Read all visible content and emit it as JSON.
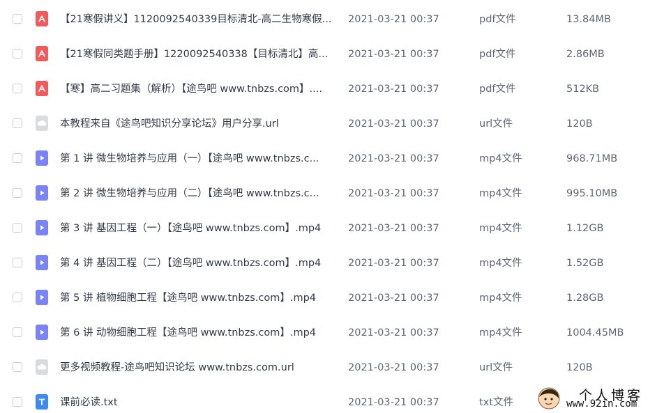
{
  "colors": {
    "pdf": "#f25b5b",
    "url": "#d9dbe0",
    "mp4": "#7b84f5",
    "txt": "#3c8bf0"
  },
  "files": [
    {
      "name": "【21寒假讲义】1120092540339目标清北-高二生物寒假...",
      "date": "2021-03-21 00:37",
      "type": "pdf文件",
      "size": "13.84MB",
      "icon": "pdf-icon"
    },
    {
      "name": "【21寒假同类题手册】1220092540338【目标清北】高...",
      "date": "2021-03-21 00:37",
      "type": "pdf文件",
      "size": "2.86MB",
      "icon": "pdf-icon"
    },
    {
      "name": "【寒】高二习题集（解析）【途鸟吧 www.tnbzs.com】....",
      "date": "2021-03-21 00:37",
      "type": "pdf文件",
      "size": "512KB",
      "icon": "pdf-icon"
    },
    {
      "name": "本教程来自《途鸟吧知识分享论坛》用户分享.url",
      "date": "2021-03-21 00:37",
      "type": "url文件",
      "size": "120B",
      "icon": "cloud-link-icon"
    },
    {
      "name": "第 1 讲 微生物培养与应用（一）【途鸟吧 www.tnbzs.c...",
      "date": "2021-03-21 00:37",
      "type": "mp4文件",
      "size": "968.71MB",
      "icon": "video-icon"
    },
    {
      "name": "第 2 讲 微生物培养与应用（二）【途鸟吧 www.tnbzs.c...",
      "date": "2021-03-21 00:37",
      "type": "mp4文件",
      "size": "995.10MB",
      "icon": "video-icon"
    },
    {
      "name": "第 3 讲 基因工程（一）【途鸟吧 www.tnbzs.com】.mp4",
      "date": "2021-03-21 00:37",
      "type": "mp4文件",
      "size": "1.12GB",
      "icon": "video-icon"
    },
    {
      "name": "第 4 讲 基因工程（二）【途鸟吧 www.tnbzs.com】.mp4",
      "date": "2021-03-21 00:37",
      "type": "mp4文件",
      "size": "1.52GB",
      "icon": "video-icon"
    },
    {
      "name": "第 5 讲 植物细胞工程【途鸟吧 www.tnbzs.com】.mp4",
      "date": "2021-03-21 00:37",
      "type": "mp4文件",
      "size": "1.28GB",
      "icon": "video-icon"
    },
    {
      "name": "第 6 讲 动物细胞工程【途鸟吧 www.tnbzs.com】.mp4",
      "date": "2021-03-21 00:37",
      "type": "mp4文件",
      "size": "1004.45MB",
      "icon": "video-icon"
    },
    {
      "name": "更多视频教程-途鸟吧知识论坛 www.tnbzs.com.url",
      "date": "2021-03-21 00:37",
      "type": "url文件",
      "size": "120B",
      "icon": "cloud-link-icon"
    },
    {
      "name": "课前必读.txt",
      "date": "2021-03-21 00:37",
      "type": "txt文件",
      "size": "",
      "icon": "text-file-icon"
    }
  ],
  "watermark": {
    "title": "个人博客",
    "url": "www.92in.com"
  }
}
